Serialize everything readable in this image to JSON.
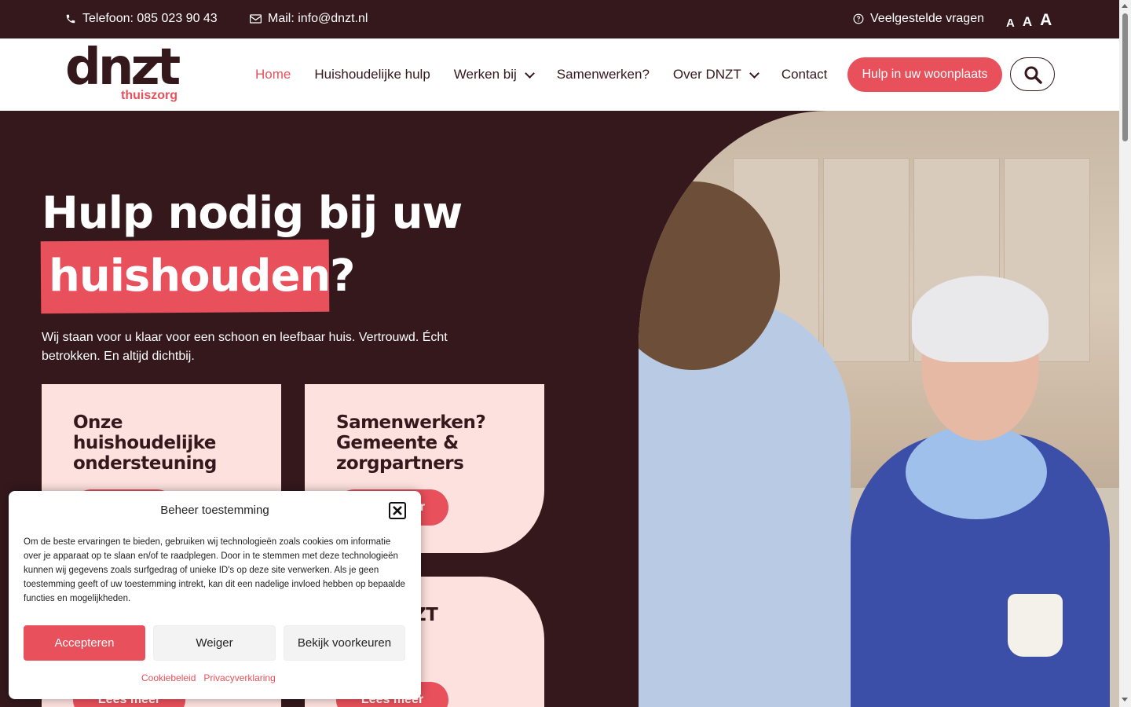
{
  "topbar": {
    "phone": "Telefoon: 085 023 90 43",
    "mail": "Mail: info@dnzt.nl",
    "faq": "Veelgestelde vragen",
    "font_sizes": [
      "A",
      "A",
      "A"
    ]
  },
  "logo": {
    "word": "dnzt",
    "sub": "thuiszorg"
  },
  "nav": {
    "items": [
      {
        "label": "Home"
      },
      {
        "label": "Huishoudelijke hulp"
      },
      {
        "label": "Werken bij"
      },
      {
        "label": "Samenwerken?"
      },
      {
        "label": "Over DNZT"
      },
      {
        "label": "Contact"
      }
    ],
    "cta": "Hulp in uw woonplaats"
  },
  "hero": {
    "line1": "Hulp nodig bij uw",
    "highlight": "huishouden",
    "question": "?",
    "intro": "Wij staan voor u klaar voor een schoon en leefbaar huis. Vertrouwd. Écht betrokken. En altijd dichtbij."
  },
  "cards": [
    {
      "title": "Onze huishoudelijke ondersteuning",
      "button": ""
    },
    {
      "title": "Samenwerken? Gemeente & zorgpartners",
      "button": "r"
    },
    {
      "title": "",
      "button": "Lees meer"
    },
    {
      "title": "ZT",
      "button": "Lees meer"
    }
  ],
  "cookie": {
    "title": "Beheer toestemming",
    "body": "Om de beste ervaringen te bieden, gebruiken wij technologieën zoals cookies om informatie over je apparaat op te slaan en/of te raadplegen. Door in te stemmen met deze technologieën kunnen wij gegevens zoals surfgedrag of unieke ID's op deze site verwerken. Als je geen toestemming geeft of uw toestemming intrekt, kan dit een nadelige invloed hebben op bepaalde functies en mogelijkheden.",
    "accept": "Accepteren",
    "deny": "Weiger",
    "prefs": "Bekijk voorkeuren",
    "link1": "Cookiebeleid",
    "link2": "Privacyverklaring"
  },
  "colors": {
    "brand_dark": "#34181c",
    "accent": "#e8505b",
    "card_bg": "#fde1de"
  }
}
